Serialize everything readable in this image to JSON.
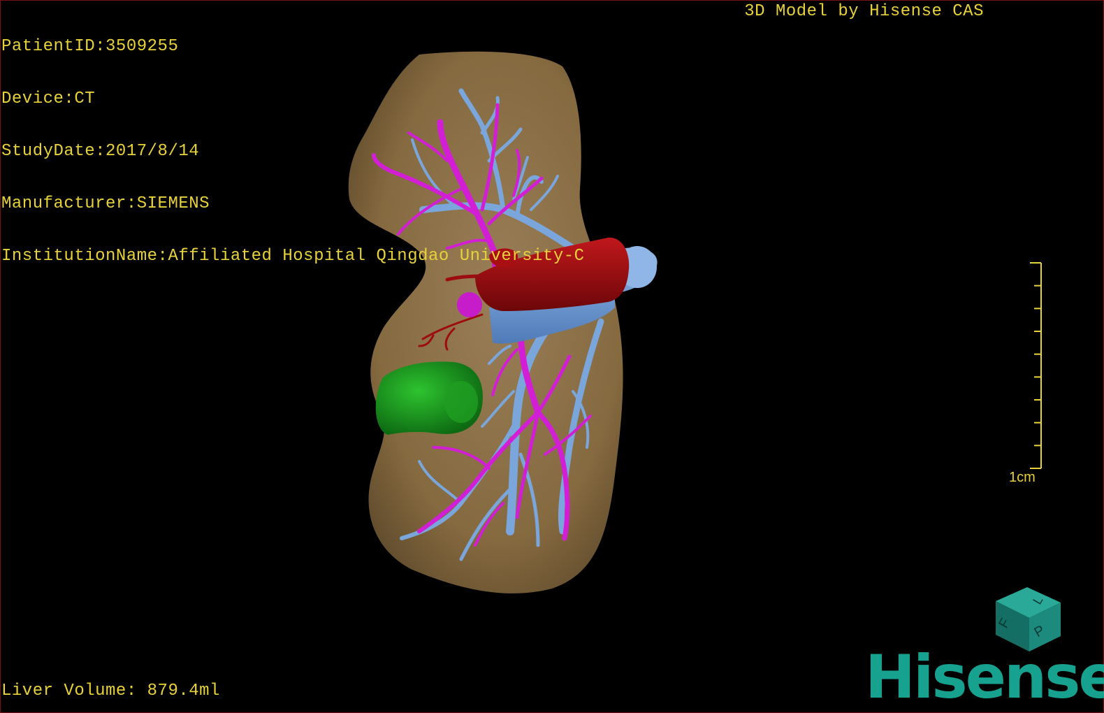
{
  "header": {
    "patient_id": "PatientID:3509255",
    "device": "Device:CT",
    "study_date": "StudyDate:2017/8/14",
    "manufacturer": "Manufacturer:SIEMENS",
    "institution": "InstitutionName:Affiliated Hospital Qingdao University-C"
  },
  "credit": "3D Model by Hisense CAS",
  "footer": {
    "liver_volume": "Liver Volume: 879.4ml"
  },
  "scale": {
    "label": "1cm",
    "ticks": 9
  },
  "orientation_cube": {
    "faces": [
      "F",
      "L",
      "P"
    ]
  },
  "brand": "Hisense",
  "colors": {
    "overlay_text": "#e8d23a",
    "liver": "#8b6f4a",
    "portal_vein": "#d21fd6",
    "hepatic_vein": "#7aa6dc",
    "artery": "#9c0c10",
    "tumor": "#159c1c",
    "brand": "#17a18f",
    "cube": "#1d8a7e"
  }
}
